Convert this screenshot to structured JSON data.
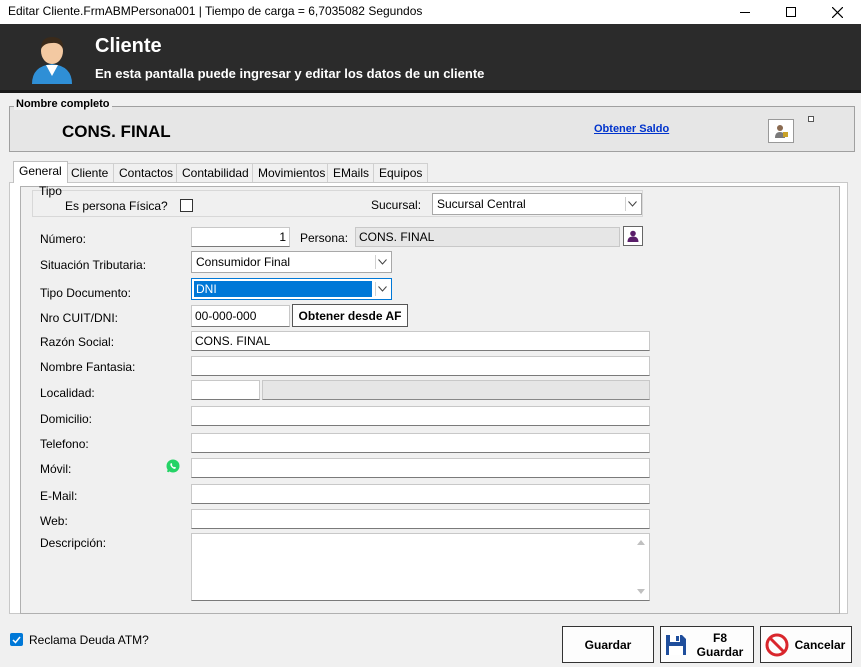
{
  "window": {
    "title": "Editar Cliente.FrmABMPersona001 | Tiempo de carga = 6,7035082 Segundos"
  },
  "header": {
    "title": "Cliente",
    "subtitle": "En esta pantalla puede ingresar y editar los datos de un cliente"
  },
  "name_group": {
    "legend": "Nombre completo",
    "value": "CONS. FINAL",
    "saldo_link": "Obtener Saldo"
  },
  "tabs": [
    "General",
    "Cliente",
    "Contactos",
    "Contabilidad",
    "Movimientos",
    "EMails",
    "Equipos"
  ],
  "tipo": {
    "legend": "Tipo",
    "persona_fisica_label": "Es persona Física?",
    "persona_fisica_checked": false,
    "sucursal_label": "Sucursal:",
    "sucursal_value": "Sucursal Central"
  },
  "form": {
    "numero_label": "Número:",
    "numero_value": "1",
    "persona_label": "Persona:",
    "persona_value": "CONS. FINAL",
    "situacion_label": "Situación Tributaria:",
    "situacion_value": "Consumidor Final",
    "tipo_doc_label": "Tipo Documento:",
    "tipo_doc_value": "DNI",
    "cuit_label": "Nro CUIT/DNI:",
    "cuit_value": "00-000-000",
    "obtener_af_label": "Obtener desde AF",
    "razon_label": "Razón Social:",
    "razon_value": "CONS. FINAL",
    "fantasia_label": "Nombre Fantasia:",
    "fantasia_value": "",
    "localidad_label": "Localidad:",
    "localidad_code": "",
    "localidad_name": "",
    "domicilio_label": "Domicilio:",
    "domicilio_value": "",
    "telefono_label": "Telefono:",
    "telefono_value": "",
    "movil_label": "Móvil:",
    "movil_value": "",
    "email_label": "E-Mail:",
    "email_value": "",
    "web_label": "Web:",
    "web_value": "",
    "descripcion_label": "Descripción:",
    "descripcion_value": ""
  },
  "footer": {
    "reclama_label": "Reclama Deuda ATM?",
    "reclama_checked": true,
    "guardar_label": "Guardar",
    "f8_key": "F8",
    "f8_label": "Guardar",
    "cancelar_label": "Cancelar"
  },
  "colors": {
    "header_bg": "#2b2b2b",
    "selection": "#0078d7",
    "whatsapp": "#25d366",
    "cancel_red": "#d9262c",
    "save_blue": "#1f4e9c"
  },
  "icons": {
    "header": "user-avatar-icon",
    "saldo": "person-money-icon",
    "persona_lookup": "person-icon",
    "movil": "whatsapp-icon",
    "f8_save": "floppy-disk-icon",
    "cancel": "no-entry-icon"
  }
}
